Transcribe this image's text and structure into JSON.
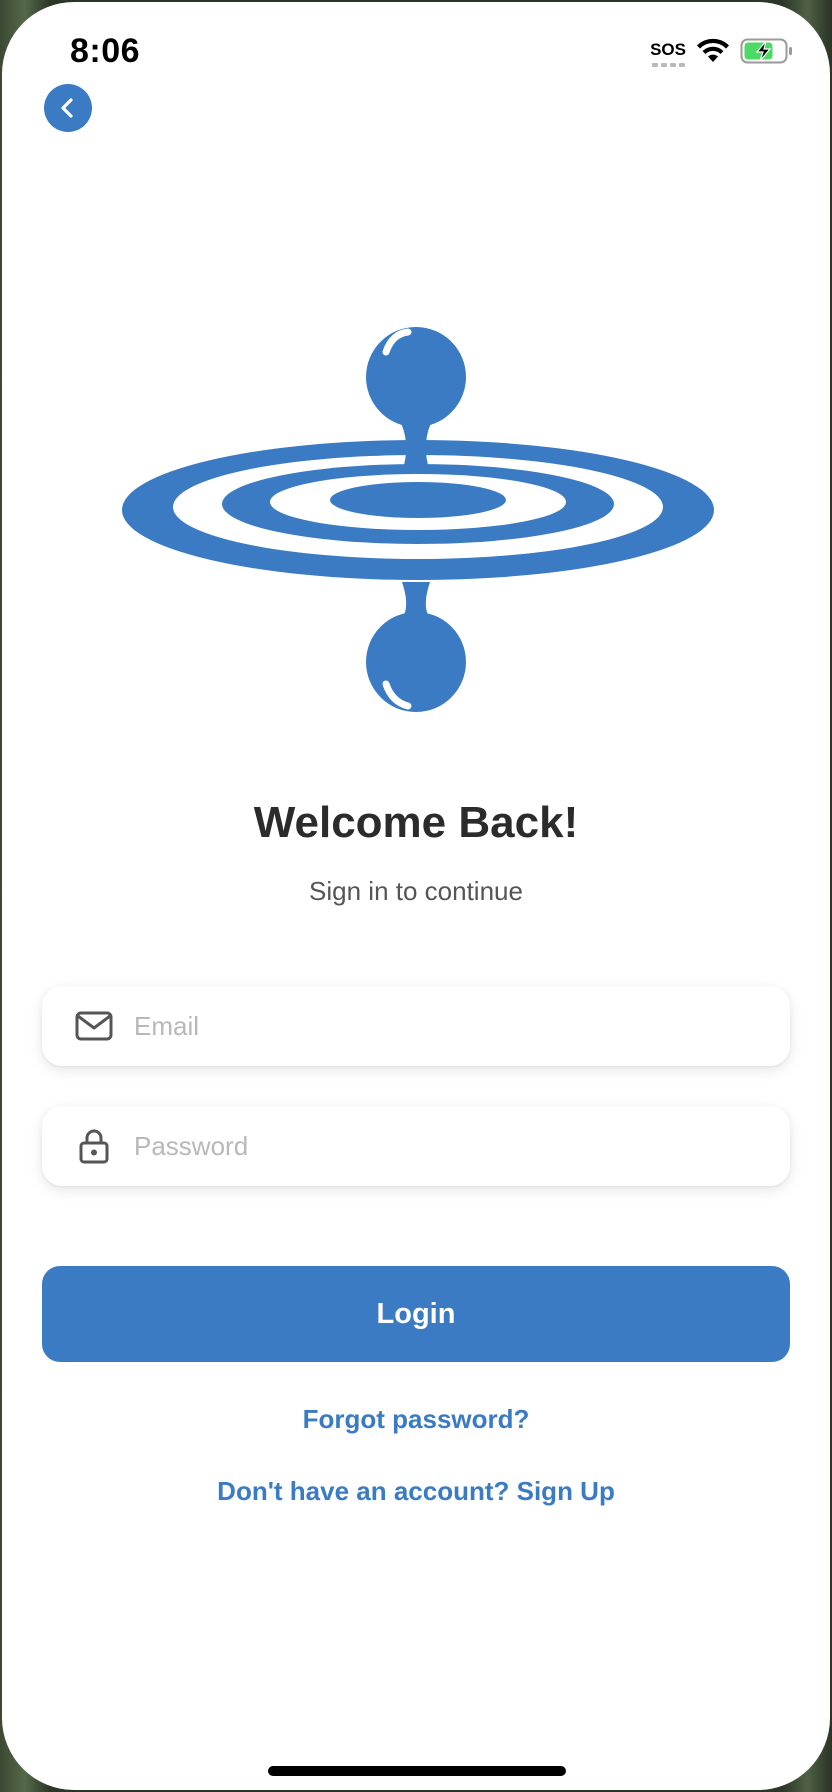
{
  "status_bar": {
    "time": "8:06",
    "sos": "SOS",
    "wifi_icon": "wifi-icon",
    "battery_icon": "battery-charging-icon"
  },
  "nav": {
    "back_icon": "chevron-left-icon"
  },
  "logo": {
    "icon": "water-drop-ripple-icon",
    "color": "#3a7bc3"
  },
  "header": {
    "title": "Welcome Back!",
    "subtitle": "Sign in to continue"
  },
  "form": {
    "email": {
      "icon": "mail-icon",
      "placeholder": "Email",
      "value": ""
    },
    "password": {
      "icon": "lock-icon",
      "placeholder": "Password",
      "value": ""
    },
    "login_label": "Login",
    "forgot_label": "Forgot password?",
    "signup_label": "Don't have an account? Sign Up"
  },
  "colors": {
    "accent": "#3a7bc3",
    "title": "#2b2b2b",
    "placeholder": "#b8b8b8"
  }
}
